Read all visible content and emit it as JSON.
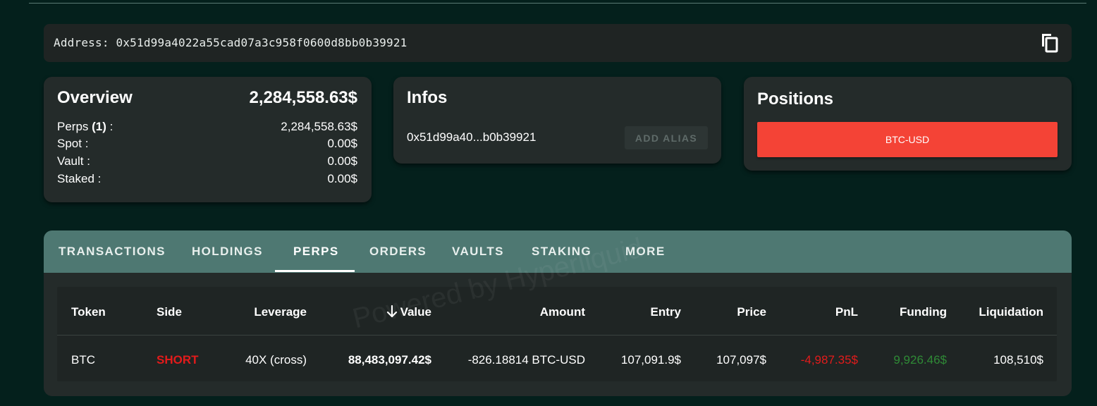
{
  "address_bar": {
    "label": "Address:",
    "address": "0x51d99a4022a55cad07a3c958f0600d8bb0b39921"
  },
  "overview": {
    "title": "Overview",
    "total": "2,284,558.63$",
    "rows": [
      {
        "label_prefix": "Perps ",
        "count": "(1)",
        "label_suffix": " :",
        "value": "2,284,558.63$"
      },
      {
        "label": "Spot :",
        "value": "0.00$"
      },
      {
        "label": "Vault :",
        "value": "0.00$"
      },
      {
        "label": "Staked :",
        "value": "0.00$"
      }
    ]
  },
  "infos": {
    "title": "Infos",
    "short_address": "0x51d99a40...b0b39921",
    "alias_button": "ADD ALIAS"
  },
  "positions": {
    "title": "Positions",
    "items": [
      "BTC-USD"
    ]
  },
  "tabs": [
    "TRANSACTIONS",
    "HOLDINGS",
    "PERPS",
    "ORDERS",
    "VAULTS",
    "STAKING",
    "MORE"
  ],
  "active_tab": "PERPS",
  "table": {
    "columns": [
      "Token",
      "Side",
      "Leverage",
      "Value",
      "Amount",
      "Entry",
      "Price",
      "PnL",
      "Funding",
      "Liquidation"
    ],
    "sorted_column": "Value",
    "rows": [
      {
        "token": "BTC",
        "side": "SHORT",
        "leverage": "40X (cross)",
        "value": "88,483,097.42$",
        "amount": "-826.18814 BTC-USD",
        "entry": "107,091.9$",
        "price": "107,097$",
        "pnl": "-4,987.35$",
        "funding": "9,926.46$",
        "liquidation": "108,510$"
      }
    ]
  },
  "watermark": "Powered by Hyperliquid",
  "colors": {
    "short": "#e21b1b",
    "negative": "#e21b1b",
    "positive": "#2f8a36",
    "position_button": "#f44336",
    "tab_bar": "#4e7872"
  },
  "icons": {
    "copy": "copy-icon",
    "sort": "arrow-down-icon"
  }
}
